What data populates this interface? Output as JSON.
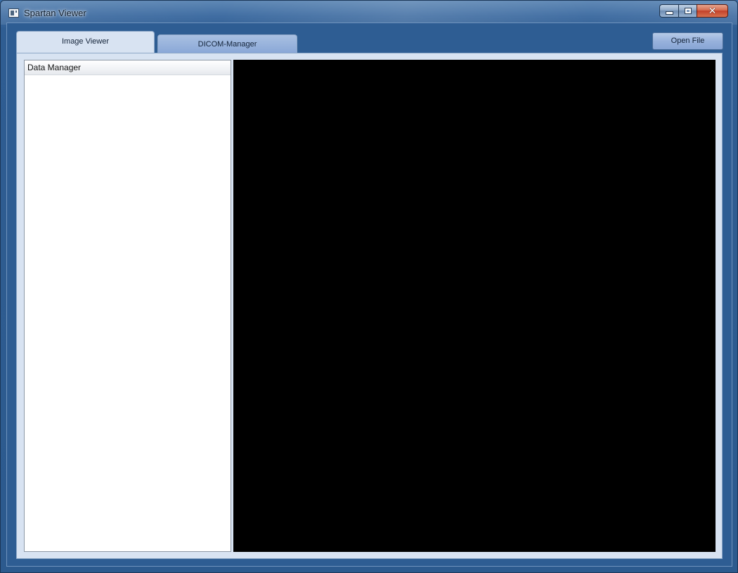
{
  "window": {
    "title": "Spartan Viewer",
    "icon": "app-window-icon"
  },
  "caption_buttons": {
    "minimize_icon": "minimize-icon",
    "maximize_icon": "maximize-icon",
    "close_icon": "close-icon",
    "close_glyph": "✕"
  },
  "tabs": [
    {
      "label": "Image Viewer",
      "active": true
    },
    {
      "label": "DICOM-Manager",
      "active": false
    }
  ],
  "toolbar": {
    "open_file_label": "Open File"
  },
  "data_manager": {
    "header": "Data Manager",
    "items": []
  },
  "viewport": {
    "background": "#000000"
  },
  "colors": {
    "frame_blue": "#2e5d93",
    "tab_active": "#d8e3f2",
    "tab_inactive": "#8aa8d7",
    "close_red": "#c2402a"
  }
}
